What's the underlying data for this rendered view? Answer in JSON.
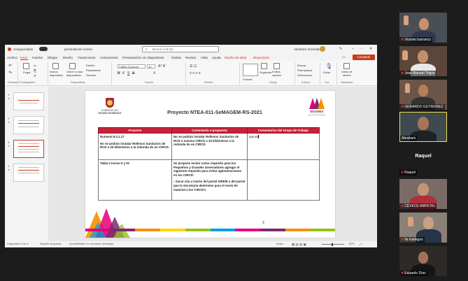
{
  "app": {
    "autosave_label": "Autoguardado",
    "doc_name": "presentación norma",
    "search_placeholder": "Buscar (Alt+Q)",
    "user_name": "Abraham Gonzalez",
    "share_label": "Compartir",
    "menu_tabs": [
      "Archivo",
      "Inicio",
      "Insertar",
      "Dibujar",
      "Diseño",
      "Transiciones",
      "Animaciones",
      "Presentación con diapositivas",
      "Grabar",
      "Revisar",
      "Vista",
      "Ayuda",
      "Diseño de tabla",
      "Disposición"
    ]
  },
  "ribbon": {
    "font_name": "Calibri (Cuerpo)",
    "font_size": "10",
    "labels": {
      "paste": "Pegar",
      "new_slide": "Nueva diapositiva",
      "reuse": "Volver a usar diapositivas",
      "layout": "Diseño",
      "reset": "Restablecer",
      "section": "Sección",
      "shapes": "Formas",
      "arrange": "Organizar",
      "quick_styles": "Estilos rápidos",
      "find": "Buscar",
      "replace": "Reemplazar",
      "select": "Seleccionar",
      "dictate": "Dictar",
      "designer": "Ideas de diseño"
    },
    "groups": [
      "Deshacer",
      "Portapapeles",
      "Diapositivas",
      "Fuente",
      "Párrafo",
      "Dibujo",
      "Edición",
      "Voz",
      "Diseñador"
    ]
  },
  "thumbnails": [
    "1",
    "2",
    "3",
    "4"
  ],
  "slide": {
    "gov_line1": "GOBIERNO DEL",
    "gov_line2": "ESTADO DE MÉXICO",
    "title": "Proyecto NTEA-011-SeMAGEM-RS-2021",
    "edomex_label": "EDOMEX",
    "edomex_sub": "DECISIONES FIRMES, RESULTADOS FUERTES",
    "table_headers": [
      "Proyecto",
      "Comentario o propuesta",
      "Comentarios del Grupo de Trabajo"
    ],
    "rows": [
      {
        "c1_title": "Numeral 6.2.1.17",
        "c1_body": "No se podrán instalar Rellenos Sanitarios de RCD a 20 kilómetros a la redonda de un CIRCD.",
        "c2_body": "No se podrán instalar Rellenos Sanitarios de RCD o nuevos CIRCD a 20 kilómetros a la redonda de un CIRCD.",
        "c3_body": "aprova"
      },
      {
        "c1_title": "Tabla 3 inciso II y III:",
        "c2_p1": "Se propone incluir como requisito para los Pequeños y Grandes Generadores agregar el siguiente requisito para evitar aglomeraciones en los CIRCD:",
        "c2_p2": "- Sacar cita a través del portal SIREM o del portal que la Secretaría determine para el envío de material a los CIRCD's",
        "c3_body": ""
      }
    ],
    "page_number": "3"
  },
  "statusbar": {
    "slide_info": "Diapositiva 3 de 4",
    "language": "Español (España)",
    "accessibility": "Accesibilidad: es necesario investigar",
    "notes": "Notas",
    "zoom": "62%"
  },
  "participants": [
    {
      "name": "Vicente barranco",
      "muted": true
    },
    {
      "name": "José Manuel Trigos",
      "muted": true
    },
    {
      "name": "GERARDO GUTIERREZ",
      "muted": true
    },
    {
      "name": "Abraham",
      "muted": false
    },
    {
      "big_name": "Raquel",
      "name": "Raquel",
      "muted": true
    },
    {
      "name": "CEVECE-MIRICHU",
      "muted": true
    },
    {
      "name": "Ila Gallegos",
      "muted": true
    },
    {
      "name": "Eduardo Díaz",
      "muted": true
    }
  ],
  "colors": {
    "ppt_accent": "#c43e1c",
    "table_header": "#c6223a",
    "active_speaker": "#f4e04c"
  }
}
